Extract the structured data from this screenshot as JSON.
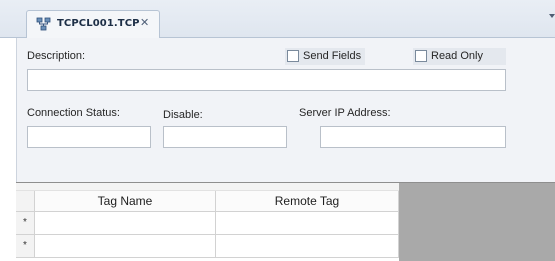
{
  "document_tab": {
    "label": "TCPCL001.TCP",
    "close_glyph": "✕",
    "icon": "network-connection-icon"
  },
  "form": {
    "description_label": "Description:",
    "description_value": "",
    "send_fields_label": "Send Fields",
    "send_fields_checked": false,
    "read_only_label": "Read Only",
    "read_only_checked": false,
    "connection_status_label": "Connection Status:",
    "connection_status_value": "",
    "disable_label": "Disable:",
    "disable_value": "",
    "server_ip_label": "Server IP Address:",
    "server_ip_value": ""
  },
  "grid": {
    "columns": [
      "Tag Name",
      "Remote Tag"
    ],
    "row_markers": [
      "*",
      "*"
    ],
    "rows": [
      [
        "",
        ""
      ],
      [
        "",
        ""
      ]
    ]
  },
  "colors": {
    "panel_bg": "#f1f3f7",
    "grid_empty_area": "#a9a9a9",
    "tab_text": "#1c2e46"
  }
}
